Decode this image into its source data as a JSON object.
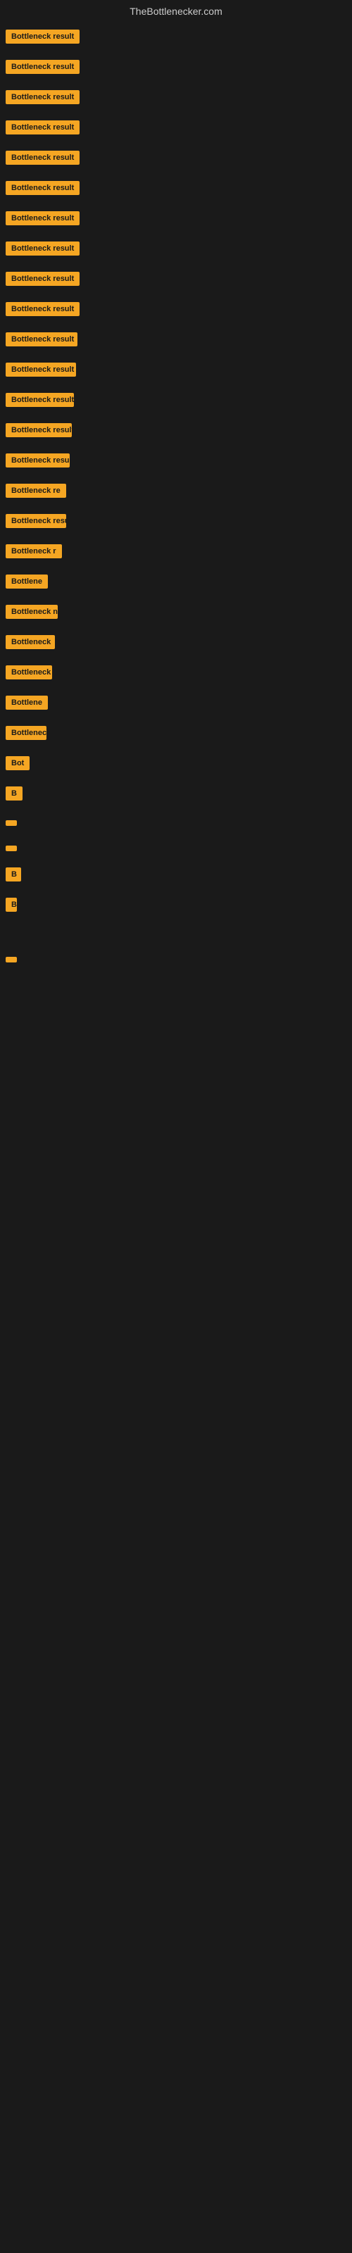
{
  "site": {
    "title": "TheBottlenecker.com"
  },
  "items": [
    {
      "id": 0,
      "label": "Bottleneck result"
    },
    {
      "id": 1,
      "label": "Bottleneck result"
    },
    {
      "id": 2,
      "label": "Bottleneck result"
    },
    {
      "id": 3,
      "label": "Bottleneck result"
    },
    {
      "id": 4,
      "label": "Bottleneck result"
    },
    {
      "id": 5,
      "label": "Bottleneck result"
    },
    {
      "id": 6,
      "label": "Bottleneck result"
    },
    {
      "id": 7,
      "label": "Bottleneck result"
    },
    {
      "id": 8,
      "label": "Bottleneck result"
    },
    {
      "id": 9,
      "label": "Bottleneck result"
    },
    {
      "id": 10,
      "label": "Bottleneck result"
    },
    {
      "id": 11,
      "label": "Bottleneck result"
    },
    {
      "id": 12,
      "label": "Bottleneck result"
    },
    {
      "id": 13,
      "label": "Bottleneck result"
    },
    {
      "id": 14,
      "label": "Bottleneck result"
    },
    {
      "id": 15,
      "label": "Bottleneck re"
    },
    {
      "id": 16,
      "label": "Bottleneck result"
    },
    {
      "id": 17,
      "label": "Bottleneck r"
    },
    {
      "id": 18,
      "label": "Bottlene"
    },
    {
      "id": 19,
      "label": "Bottleneck n"
    },
    {
      "id": 20,
      "label": "Bottleneck"
    },
    {
      "id": 21,
      "label": "Bottleneck res"
    },
    {
      "id": 22,
      "label": "Bottlene"
    },
    {
      "id": 23,
      "label": "Bottleneck"
    },
    {
      "id": 24,
      "label": "Bot"
    },
    {
      "id": 25,
      "label": "B"
    },
    {
      "id": 26,
      "label": ""
    },
    {
      "id": 27,
      "label": ""
    },
    {
      "id": 28,
      "label": "B"
    },
    {
      "id": 29,
      "label": "Bott"
    },
    {
      "id": 30,
      "label": ""
    },
    {
      "id": 31,
      "label": ""
    },
    {
      "id": 32,
      "label": ""
    },
    {
      "id": 33,
      "label": ""
    },
    {
      "id": 34,
      "label": ""
    },
    {
      "id": 35,
      "label": ""
    }
  ]
}
